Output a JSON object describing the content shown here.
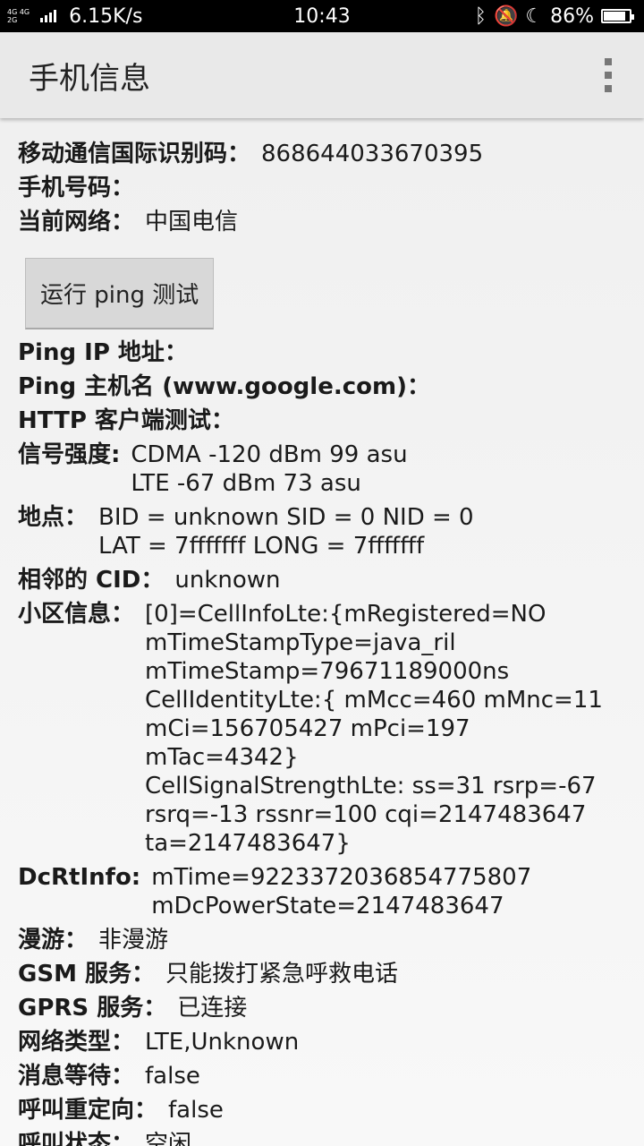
{
  "status_bar": {
    "network_badges": [
      "4G 4G",
      "2G"
    ],
    "speed": "6.15K/s",
    "time": "10:43",
    "battery_percent": "86%",
    "battery_level": 0.86
  },
  "app_bar": {
    "title": "手机信息"
  },
  "info": {
    "imei_label": "移动通信国际识别码：",
    "imei_value": "868644033670395",
    "phone_label": "手机号码：",
    "phone_value": "",
    "network_label": "当前网络：",
    "network_value": "中国电信"
  },
  "ping_button_label": "运行 ping 测试",
  "details": [
    {
      "label": "Ping IP 地址：",
      "value": ""
    },
    {
      "label": "Ping 主机名 (www.google.com)：",
      "value": ""
    },
    {
      "label": "HTTP 客户端测试：",
      "value": ""
    },
    {
      "label": "信号强度:",
      "value": "CDMA -120 dBm   99 asu\nLTE -67 dBm   73 asu"
    },
    {
      "label": "地点：",
      "value": "BID = unknown   SID = 0   NID = 0\nLAT = 7fffffff   LONG = 7fffffff"
    },
    {
      "label": "相邻的 CID：",
      "value": "unknown"
    },
    {
      "label": "小区信息：",
      "value": "[0]=CellInfoLte:{mRegistered=NO\nmTimeStampType=java_ril\nmTimeStamp=79671189000ns\nCellIdentityLte:{ mMcc=460 mMnc=11\nmCi=156705427 mPci=197 mTac=4342}\nCellSignalStrengthLte: ss=31 rsrp=-67\nrsrq=-13 rssnr=100 cqi=2147483647\nta=2147483647}"
    },
    {
      "label": "DcRtInfo:",
      "value": "mTime=9223372036854775807\nmDcPowerState=2147483647"
    },
    {
      "label": "漫游：",
      "value": "非漫游"
    },
    {
      "label": "GSM 服务：",
      "value": "只能拨打紧急呼救电话"
    },
    {
      "label": "GPRS 服务：",
      "value": "已连接"
    },
    {
      "label": "网络类型：",
      "value": "LTE,Unknown"
    },
    {
      "label": "消息等待：",
      "value": "false"
    },
    {
      "label": "呼叫重定向：",
      "value": "false"
    },
    {
      "label": "呼叫状态：",
      "value": "空闲"
    }
  ]
}
